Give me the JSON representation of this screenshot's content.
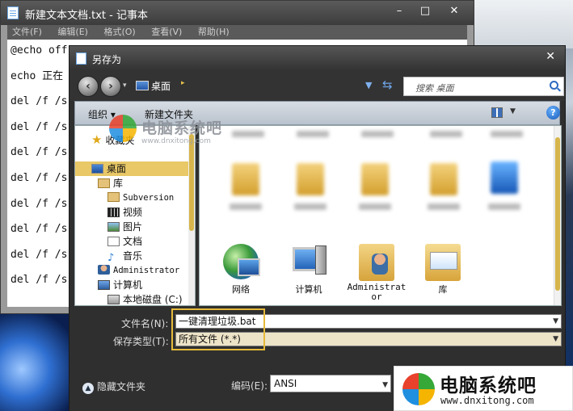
{
  "notepad": {
    "title": "新建文本文档.txt - 记事本",
    "controls": [
      "–",
      "□",
      "✕"
    ],
    "menus": [
      "文件(F)",
      "编辑(E)",
      "格式(O)",
      "查看(V)",
      "帮助(H)"
    ],
    "lines": [
      "@echo off",
      "echo 正在",
      "del /f /s",
      "del /f /s",
      "del /f /s",
      "del /f /s",
      "del /f /s",
      "del /f /s",
      "del /f /s",
      "del /f /s"
    ]
  },
  "dialog": {
    "title": "另存为",
    "close": "✕",
    "address": "桌面",
    "search_placeholder": "搜索 桌面",
    "toolbar": {
      "organize": "组织 ▾",
      "new_folder": "新建文件夹",
      "help": "?"
    },
    "nav_items": [
      {
        "label": "收藏夹",
        "icon": "star-icon"
      },
      {
        "label": "桌面",
        "icon": "desktop-icon",
        "selected": true
      },
      {
        "label": "库",
        "icon": "library-icon"
      },
      {
        "label": "Subversion",
        "icon": "folder-icon"
      },
      {
        "label": "视频",
        "icon": "video-icon"
      },
      {
        "label": "图片",
        "icon": "picture-icon"
      },
      {
        "label": "文档",
        "icon": "document-icon"
      },
      {
        "label": "音乐",
        "icon": "music-icon"
      },
      {
        "label": "Administrator",
        "icon": "user-icon"
      },
      {
        "label": "计算机",
        "icon": "computer-icon"
      },
      {
        "label": "本地磁盘 (C:)",
        "icon": "drive-icon"
      }
    ],
    "content_items": [
      {
        "label": "网络",
        "icon": "network-icon"
      },
      {
        "label": "计算机",
        "icon": "computer-icon"
      },
      {
        "label": "Administrator",
        "icon": "user-folder-icon"
      },
      {
        "label": "库",
        "icon": "library-icon"
      }
    ],
    "filename_label": "文件名(N):",
    "filename_value": "一键清理垃圾.bat",
    "filetype_label": "保存类型(T):",
    "filetype_value": "所有文件  (*.*)",
    "hide_folders": "隐藏文件夹",
    "encoding_label": "编码(E):",
    "encoding_value": "ANSI"
  },
  "watermark": {
    "center_title": "电脑系统吧",
    "center_url": "www.dnxitong.com",
    "brand_title": "电脑系统吧",
    "brand_url": "www.dnxitong.com",
    "logo_colors": [
      "#e8412c",
      "#35a838",
      "#1f8fe0",
      "#f5b400"
    ]
  }
}
